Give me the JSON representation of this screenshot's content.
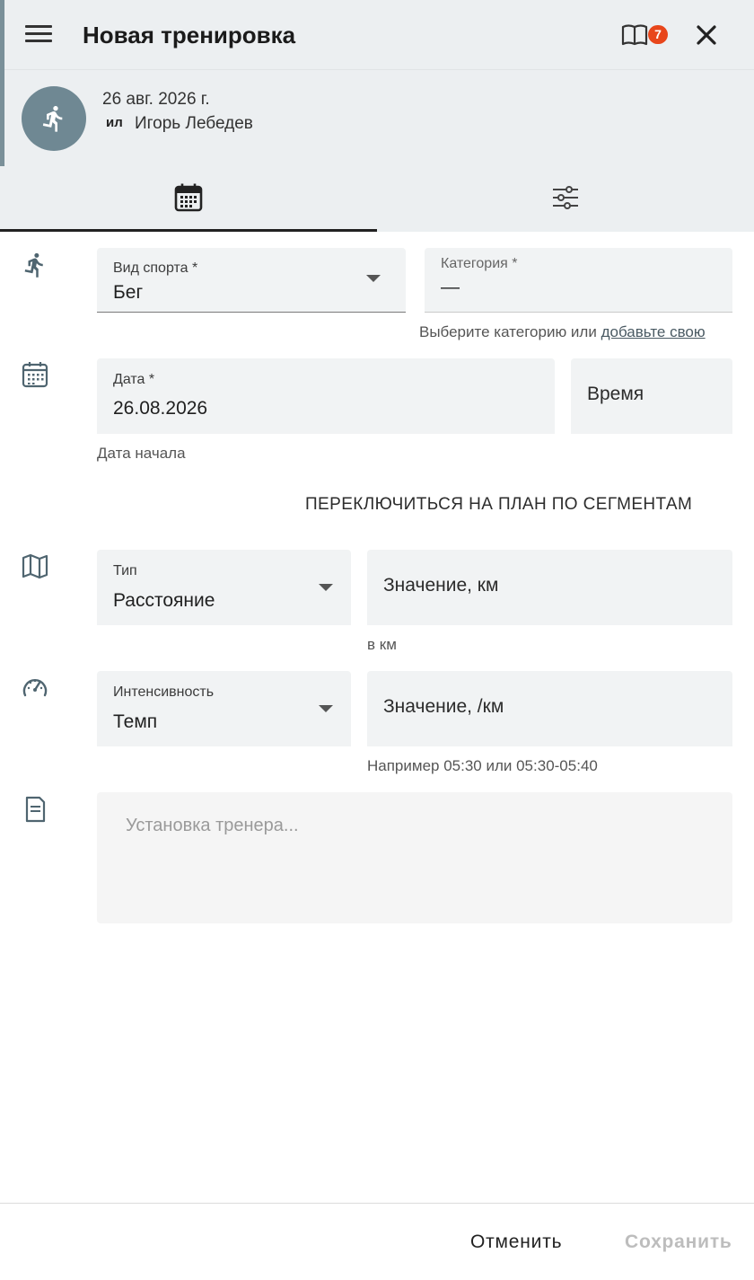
{
  "header": {
    "title": "Новая тренировка",
    "badge_count": "7"
  },
  "info": {
    "date": "26 авг. 2026 г.",
    "initials": "ил",
    "athlete_name": "Игорь Лебедев"
  },
  "tabs": [
    {
      "name": "calendar",
      "icon": "calendar-icon",
      "active": true
    },
    {
      "name": "settings",
      "icon": "sliders-icon",
      "active": false
    }
  ],
  "sport": {
    "label": "Вид спорта *",
    "value": "Бег"
  },
  "category": {
    "label": "Категория *",
    "value": "—",
    "helper_text": "Выберите категорию или",
    "helper_link": "добавьте свою"
  },
  "date": {
    "label": "Дата *",
    "value": "26.08.2026",
    "helper": "Дата начала"
  },
  "time": {
    "placeholder": "Время"
  },
  "switch_link": "ПЕРЕКЛЮЧИТЬСЯ НА ПЛАН ПО СЕГМЕНТАМ",
  "type": {
    "label": "Тип",
    "value": "Расстояние"
  },
  "distance": {
    "placeholder": "Значение, км",
    "helper": "в км"
  },
  "intensity": {
    "label": "Интенсивность",
    "value": "Темп"
  },
  "pace": {
    "placeholder": "Значение, /км",
    "helper": "Например 05:30 или 05:30-05:40"
  },
  "notes": {
    "placeholder": "Установка тренера..."
  },
  "footer": {
    "cancel_label": "Отменить",
    "save_label": "Сохранить"
  },
  "colors": {
    "header_bg": "#eceff1",
    "avatar_bg": "#6f8893",
    "badge": "#e8461b",
    "field_bg": "#f1f3f4",
    "save_disabled": "#bdbdbd"
  }
}
